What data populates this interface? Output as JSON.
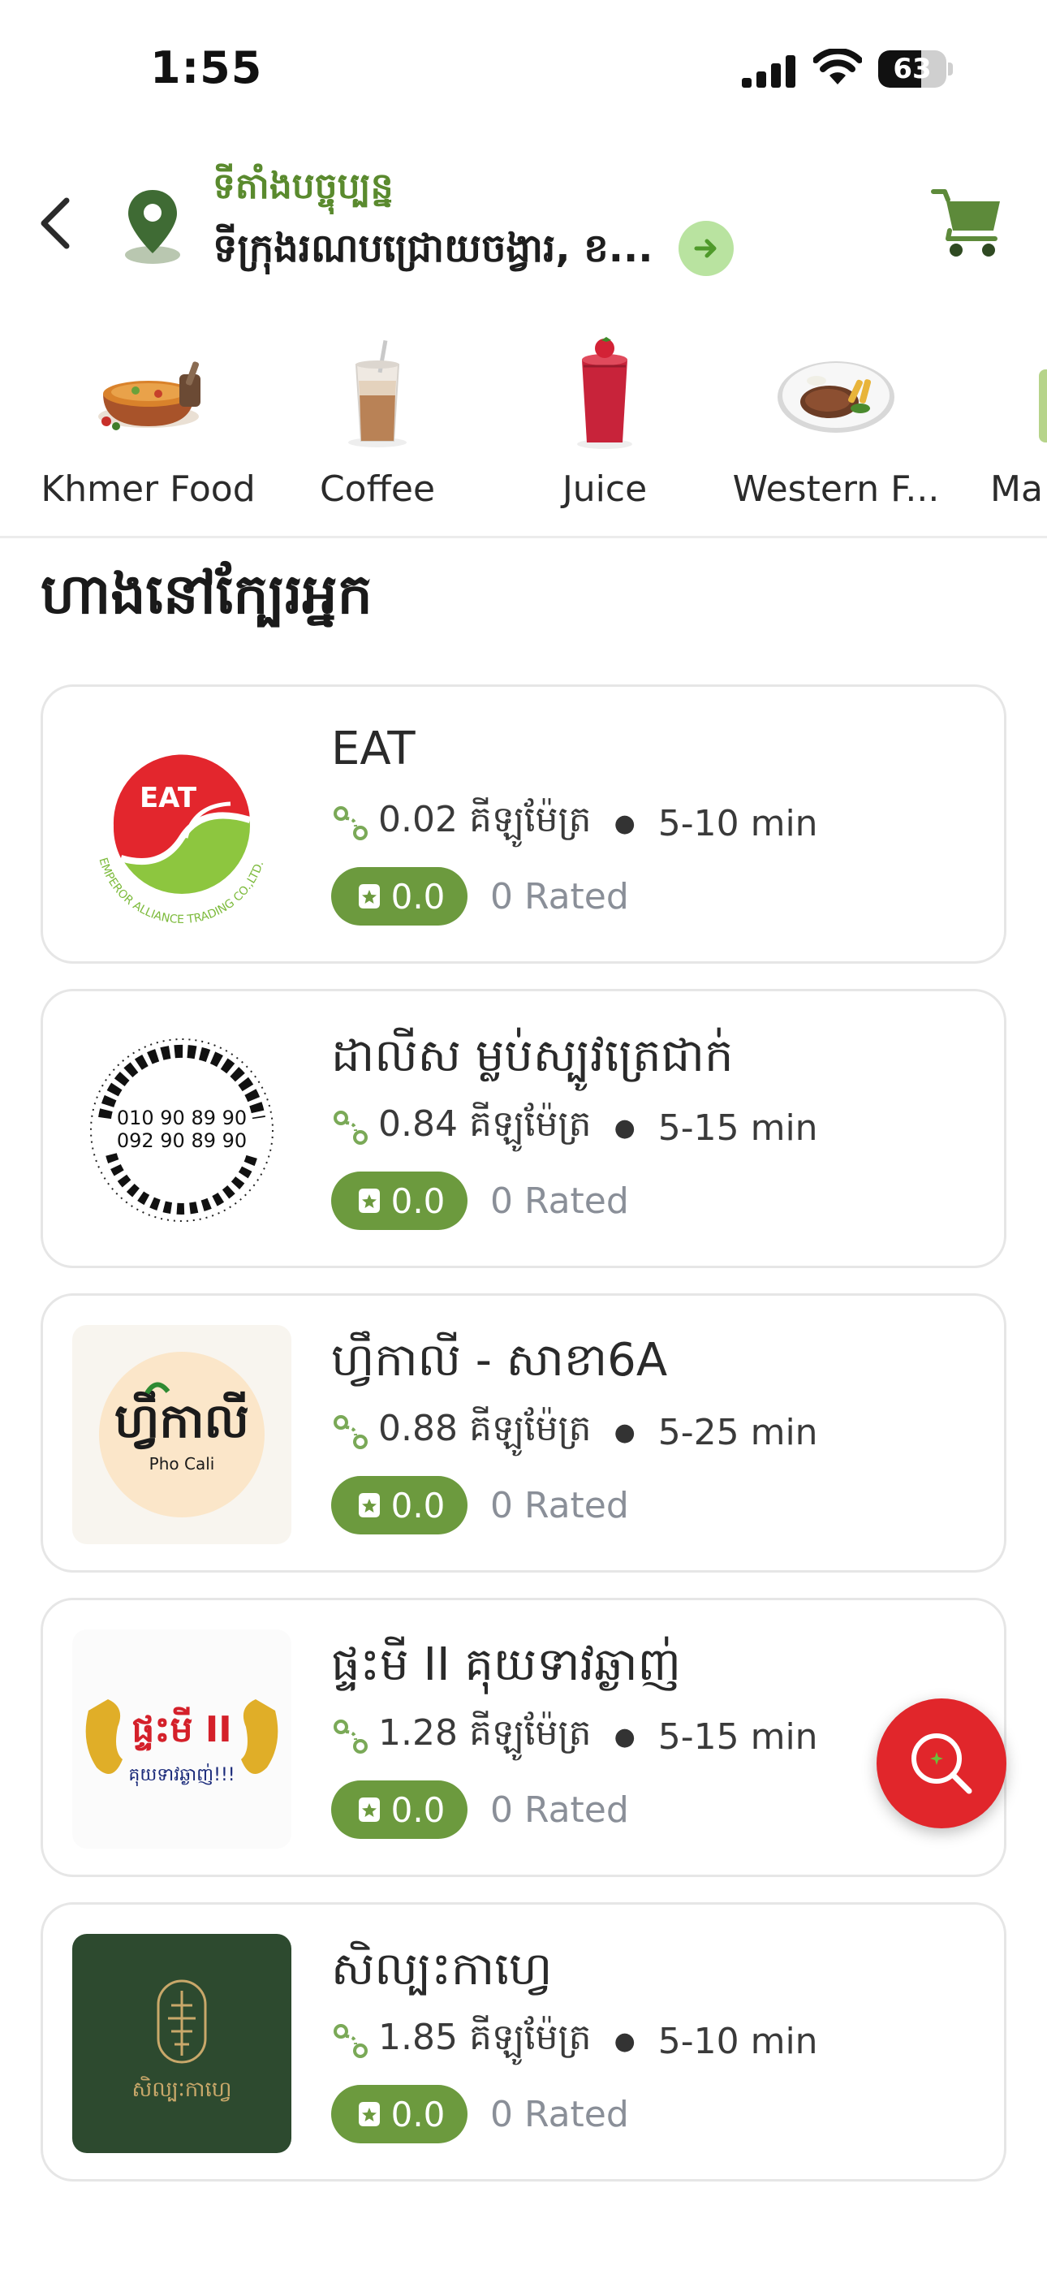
{
  "status_bar": {
    "time": "1:55",
    "battery": "63",
    "battery_level": 0.63
  },
  "header": {
    "location_label": "ទីតាំងបច្ចុប្បន្ន",
    "location_address": "ទីក្រុងរណបជ្រោយចង្វារ, ខ...",
    "icons": [
      "back-icon",
      "location-pin-icon",
      "arrow-right-icon",
      "cart-icon"
    ],
    "accent_color": "#5a8a2e"
  },
  "categories": [
    {
      "label": "Khmer Food",
      "icon": "khmer-food-icon"
    },
    {
      "label": "Coffee",
      "icon": "coffee-icon"
    },
    {
      "label": "Juice",
      "icon": "juice-icon"
    },
    {
      "label": "Western F...",
      "icon": "western-food-icon"
    },
    {
      "label": "Ma",
      "icon": "more-category-icon"
    }
  ],
  "section": {
    "title": "ហាងនៅក្បែរអ្នក"
  },
  "stores": [
    {
      "name": "EAT",
      "distance": "0.02 គីឡូម៉ែត្រ",
      "time": "5-10 min",
      "rating": "0.0",
      "rated": "0 Rated",
      "logo": "eat-logo",
      "logo_text": "EAT"
    },
    {
      "name": "ដាលីស ម្លប់ស្បូវត្រេជាក់",
      "distance": "0.84 គីឡូម៉ែត្រ",
      "time": "5-15 min",
      "rating": "0.0",
      "rated": "0 Rated",
      "logo": "stamp-logo",
      "logo_text": "010 90 89 90\n092 90 89 90"
    },
    {
      "name": "ហ្វឹកាលី - សាខា6A",
      "distance": "0.88 គីឡូម៉ែត្រ",
      "time": "5-25 min",
      "rating": "0.0",
      "rated": "0 Rated",
      "logo": "pho-cali-logo",
      "logo_text": "Pho Cali"
    },
    {
      "name": "ផ្ទះមី II គុយទាវឆ្ងាញ់",
      "distance": "1.28 គីឡូម៉ែត្រ",
      "time": "5-15 min",
      "rating": "0.0",
      "rated": "0 Rated",
      "logo": "dragon-logo",
      "logo_text": "ផ្ទះមី II"
    },
    {
      "name": "សិល្បះកាហ្វេ",
      "distance": "1.85 គីឡូម៉ែត្រ",
      "time": "5-10 min",
      "rating": "0.0",
      "rated": "0 Rated",
      "logo": "silpak-coffee-logo",
      "logo_text": "សិល្បៈកាហ្វេ"
    }
  ],
  "fab": {
    "icon": "search-icon",
    "color": "#e1262b"
  }
}
